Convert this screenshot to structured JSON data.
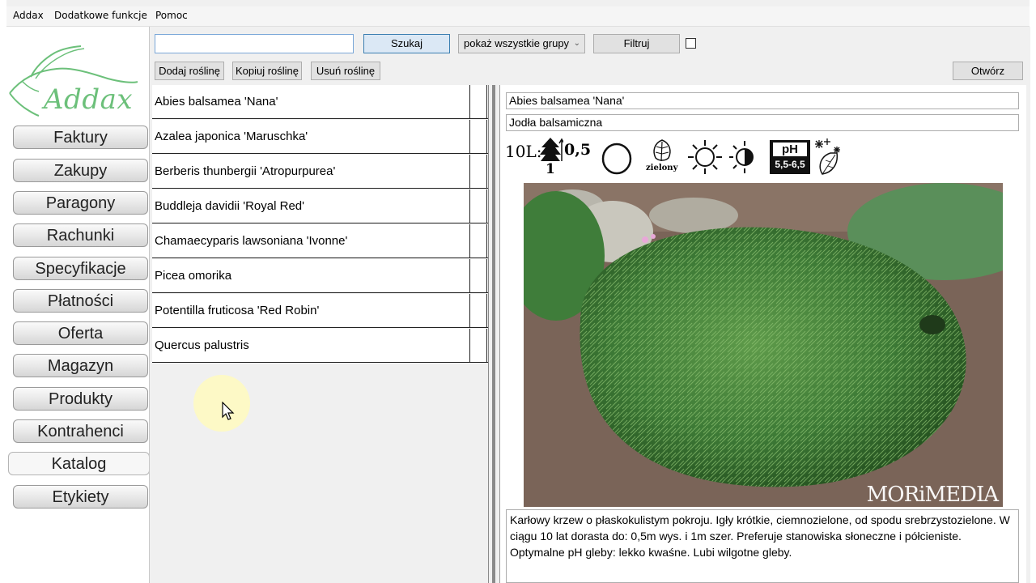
{
  "menu": [
    "Addax",
    "Dodatkowe funkcje",
    "Pomoc"
  ],
  "logo_text": "Addax",
  "nav": [
    {
      "label": "Faktury"
    },
    {
      "label": "Zakupy"
    },
    {
      "label": "Paragony"
    },
    {
      "label": "Rachunki"
    },
    {
      "label": "Specyfikacje"
    },
    {
      "label": "Płatności"
    },
    {
      "label": "Oferta"
    },
    {
      "label": "Magazyn"
    },
    {
      "label": "Produkty"
    },
    {
      "label": "Kontrahenci"
    },
    {
      "label": "Katalog"
    },
    {
      "label": "Etykiety"
    }
  ],
  "nav_active": "Katalog",
  "toolbar": {
    "search_value": "",
    "search_button": "Szukaj",
    "group_select": "pokaż wszystkie grupy",
    "filter_button": "Filtruj",
    "add_button": "Dodaj roślinę",
    "copy_button": "Kopiuj roślinę",
    "remove_button": "Usuń roślinę",
    "open_button": "Otwórz"
  },
  "plants": [
    "Abies balsamea 'Nana'",
    "Azalea japonica 'Maruschka'",
    "Berberis thunbergii 'Atropurpurea'",
    "Buddleja davidii 'Royal Red'",
    "Chamaecyparis lawsoniana 'Ivonne'",
    "Picea omorika",
    "Potentilla fruticosa 'Red Robin'",
    "Quercus palustris"
  ],
  "detail": {
    "latin_name": "Abies balsamea 'Nana'",
    "polish_name": "Jodła balsamiczna",
    "growth_prefix": "10L:",
    "growth_height": "0,5",
    "growth_width": "1",
    "foliage_label": "zielony",
    "ph_label": "pH",
    "ph_range": "5,5-6,5",
    "photo_watermark": "MORiMEDIA",
    "description": "Karłowy krzew o płaskokulistym pokroju. Igły krótkie, ciemnozielone, od spodu srebrzystozielone. W ciągu 10 lat dorasta do: 0,5m wys. i 1m szer. Preferuje stanowiska słoneczne i półcieniste. Optymalne pH gleby: lekko kwaśne. Lubi wilgotne gleby."
  },
  "colors": {
    "logo_green": "#6cc07a",
    "selected_border": "#3c7fb1"
  }
}
